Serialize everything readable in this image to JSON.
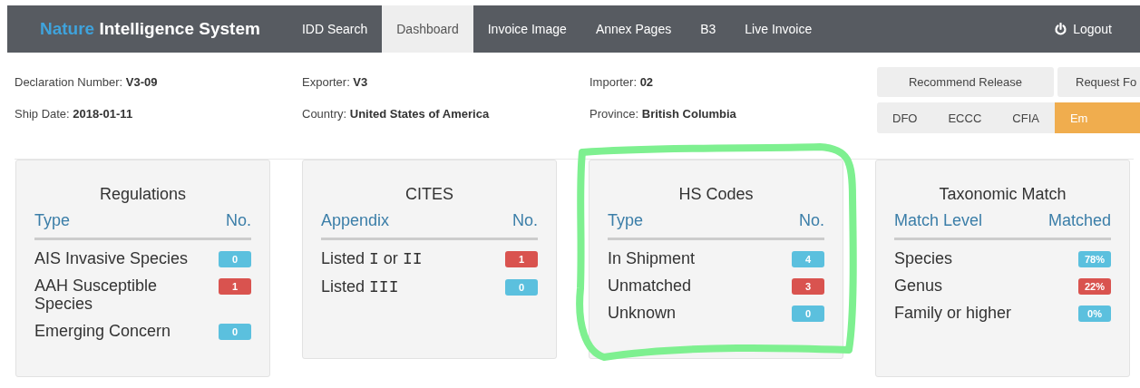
{
  "navbar": {
    "brand_accent": "Nature",
    "brand_rest": "Intelligence System",
    "items": [
      {
        "label": "IDD Search",
        "selected": false
      },
      {
        "label": "Dashboard",
        "selected": true
      },
      {
        "label": "Invoice Image",
        "selected": false
      },
      {
        "label": "Annex Pages",
        "selected": false
      },
      {
        "label": "B3",
        "selected": false
      },
      {
        "label": "Live Invoice",
        "selected": false
      }
    ],
    "logout": "Logout"
  },
  "details": [
    {
      "label": "Declaration Number:",
      "value": "V3-09"
    },
    {
      "label": "Exporter:",
      "value": "V3"
    },
    {
      "label": "Importer:",
      "value": "02"
    },
    {
      "label": "Ship Date:",
      "value": "2018-01-11"
    },
    {
      "label": "Country:",
      "value": "United States of America"
    },
    {
      "label": "Province:",
      "value": "British Columbia"
    }
  ],
  "actions": [
    "Recommend Release",
    "Request Fo"
  ],
  "agencies": [
    {
      "label": "DFO",
      "selected": false
    },
    {
      "label": "ECCC",
      "selected": false
    },
    {
      "label": "CFIA",
      "selected": false
    },
    {
      "label": "Em",
      "selected": true
    }
  ],
  "cards": [
    {
      "title": "Regulations",
      "column_1": "Type",
      "column_2": "No.",
      "highlighted": false,
      "rows": [
        {
          "label": [
            {
              "text": "AIS Invasive Species",
              "mono": false
            }
          ],
          "count": "0",
          "color": "#5bc0de"
        },
        {
          "label": [
            {
              "text": "AAH Susceptible Species",
              "mono": false
            }
          ],
          "count": "1",
          "color": "#d9534f"
        },
        {
          "label": [
            {
              "text": "Emerging Concern",
              "mono": false
            }
          ],
          "count": "0",
          "color": "#5bc0de"
        }
      ]
    },
    {
      "title": "CITES",
      "column_1": "Appendix",
      "column_2": "No.",
      "highlighted": false,
      "rows": [
        {
          "label": [
            {
              "text": "Listed ",
              "mono": false
            },
            {
              "text": "I",
              "mono": true
            },
            {
              "text": " or ",
              "mono": false
            },
            {
              "text": "II",
              "mono": true
            }
          ],
          "count": "1",
          "color": "#d9534f"
        },
        {
          "label": [
            {
              "text": "Listed ",
              "mono": false
            },
            {
              "text": "III",
              "mono": true
            }
          ],
          "count": "0",
          "color": "#5bc0de"
        }
      ]
    },
    {
      "title": "HS Codes",
      "column_1": "Type",
      "column_2": "No.",
      "highlighted": true,
      "rows": [
        {
          "label": [
            {
              "text": "In Shipment",
              "mono": false
            }
          ],
          "count": "4",
          "color": "#5bc0de"
        },
        {
          "label": [
            {
              "text": "Unmatched",
              "mono": false
            }
          ],
          "count": "3",
          "color": "#d9534f"
        },
        {
          "label": [
            {
              "text": "Unknown",
              "mono": false
            }
          ],
          "count": "0",
          "color": "#5bc0de"
        }
      ]
    },
    {
      "title": "Taxonomic Match",
      "column_1": "Match Level",
      "column_2": "Matched",
      "highlighted": false,
      "rows": [
        {
          "label": [
            {
              "text": "Species",
              "mono": false
            }
          ],
          "count": "78%",
          "color": "#5bc0de"
        },
        {
          "label": [
            {
              "text": "Genus",
              "mono": false
            }
          ],
          "count": "22%",
          "color": "#d9534f"
        },
        {
          "label": [
            {
              "text": "Family or higher",
              "mono": false
            }
          ],
          "count": "0%",
          "color": "#5bc0de"
        }
      ]
    }
  ]
}
